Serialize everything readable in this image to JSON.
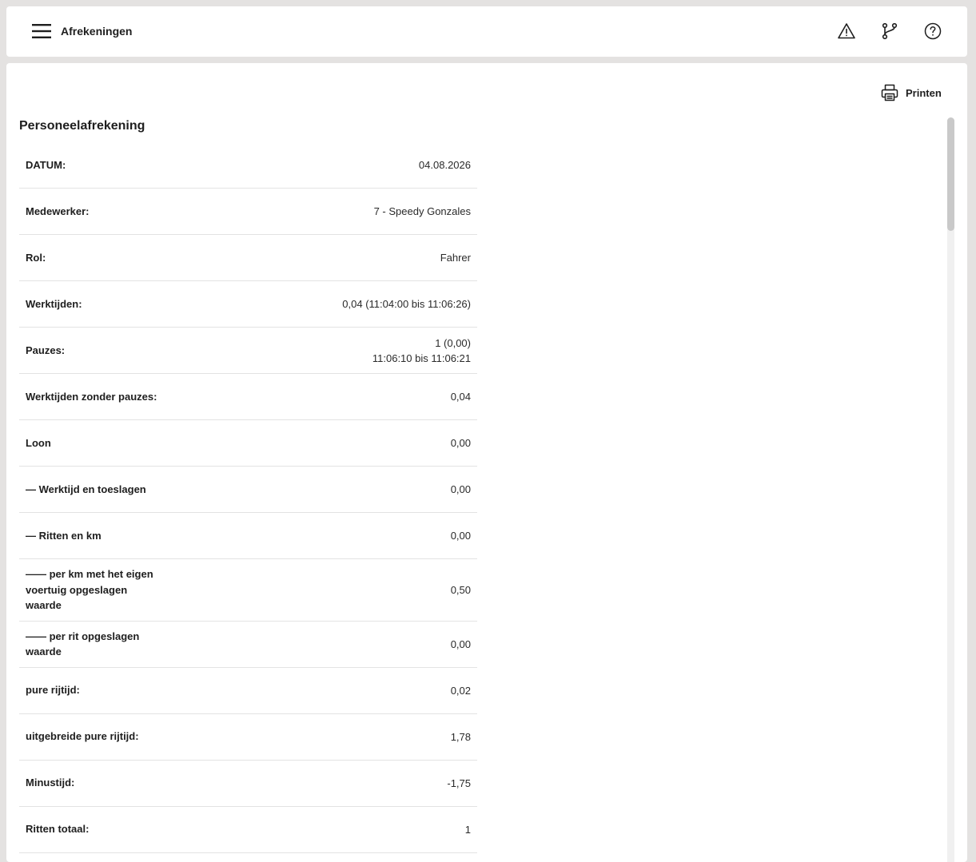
{
  "header": {
    "title": "Afrekeningen",
    "icons": [
      "menu-icon",
      "warning-icon",
      "git-branch-icon",
      "help-icon"
    ]
  },
  "toolbar": {
    "print_label": "Printen"
  },
  "page": {
    "title": "Personeelafrekening"
  },
  "rows": [
    {
      "label": "DATUM:",
      "value": "04.08.2026"
    },
    {
      "label": "Medewerker:",
      "value": "7 - Speedy Gonzales"
    },
    {
      "label": "Rol:",
      "value": "Fahrer"
    },
    {
      "label": "Werktijden:",
      "value": "0,04 (11:04:00 bis 11:06:26)"
    },
    {
      "label": "Pauzes:",
      "value": "1 (0,00)",
      "value2": "11:06:10 bis 11:06:21"
    },
    {
      "label": "Werktijden zonder pauzes:",
      "value": "0,04"
    },
    {
      "label": "Loon",
      "value": "0,00"
    },
    {
      "label": "— Werktijd en toeslagen",
      "value": "0,00"
    },
    {
      "label": "— Ritten en km",
      "value": "0,00"
    },
    {
      "label": "—— per km met het eigen voertuig opgeslagen waarde",
      "value": "0,50"
    },
    {
      "label": "—— per rit opgeslagen waarde",
      "value": "0,00"
    },
    {
      "label": "pure rijtijd:",
      "value": "0,02"
    },
    {
      "label": "uitgebreide pure rijtijd:",
      "value": "1,78"
    },
    {
      "label": "Minustijd:",
      "value": "-1,75"
    },
    {
      "label": "Ritten totaal:",
      "value": "1"
    }
  ],
  "colors": {
    "background": "#e4e2e1",
    "panel": "#ffffff",
    "text": "#1e1e1e",
    "divider": "#e3e3e3"
  }
}
